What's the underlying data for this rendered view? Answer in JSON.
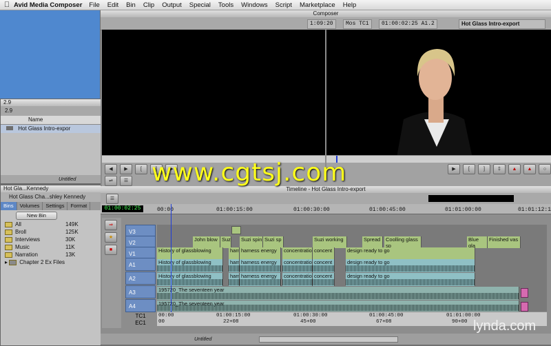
{
  "menubar": {
    "app_name": "Avid Media Composer",
    "items": [
      "File",
      "Edit",
      "Bin",
      "Clip",
      "Output",
      "Special",
      "Tools",
      "Windows",
      "Script",
      "Marketplace",
      "Help"
    ]
  },
  "composer": {
    "title": "Composer",
    "source_tc": "1:09:20",
    "mas_label": "Mos TC1",
    "record_tc": "01:00:02:25 A1.2",
    "sequence_name": "Hot Glass Intro-export"
  },
  "small_bin": {
    "title": "2.9",
    "tab": "2.9",
    "col_name": "Name",
    "item": "Hot Glass Intro-expor",
    "footer": "Untitled"
  },
  "project_window": {
    "title": "Hot Gla...Kennedy",
    "subtitle": "Hot Glass Cha...shley Kennedy",
    "tabs": [
      "Bins",
      "Volumes",
      "Settings",
      "Format"
    ],
    "new_bin": "New Bin",
    "bins": [
      {
        "name": "All",
        "size": "149K"
      },
      {
        "name": "Broll",
        "size": "125K"
      },
      {
        "name": "Interviews",
        "size": "30K"
      },
      {
        "name": "Music",
        "size": "11K"
      },
      {
        "name": "Narration",
        "size": "13K"
      },
      {
        "name": "Chapter 2 Ex Files",
        "size": ""
      }
    ]
  },
  "timeline": {
    "title": "Timeline - Hot Glass Intro-export",
    "timecode": "01:00:02:25",
    "ruler": [
      "00:00",
      "01:00:15:00",
      "01:00:30:00",
      "01:00:45:00",
      "01:01:00:00",
      "01:01:12:1"
    ],
    "tc1_marks": [
      "00:00",
      "01:00:15:00",
      "01:00:30:00",
      "01:00:45:00",
      "01:01:00:00"
    ],
    "ec1_marks": [
      "00",
      "22+08",
      "45+00",
      "67+08",
      "90+00"
    ],
    "tracks": [
      "V3",
      "V2",
      "V1",
      "A1",
      "A2",
      "A3",
      "A4",
      "TC1",
      "EC1"
    ],
    "v2_clips": [
      "John blow",
      "Suz",
      "Suzi spin",
      "Suzi sp",
      "Suzi working",
      "Spread",
      "Coolling glass sp",
      "Blue gla",
      "Finished vas"
    ],
    "v1_clips": [
      "History of glassblowing",
      "harn",
      "harness energy",
      "concentratio",
      "concent",
      "design ready to go"
    ],
    "a_clips": [
      "History of glassblowing",
      "harn",
      "harness energy",
      "concentratio",
      "concent",
      "design ready to go"
    ],
    "music_clip": "195720_The seventeen year",
    "footer": "Untitled"
  },
  "watermark": "www.cgtsj.com",
  "brand": "lynda.com"
}
